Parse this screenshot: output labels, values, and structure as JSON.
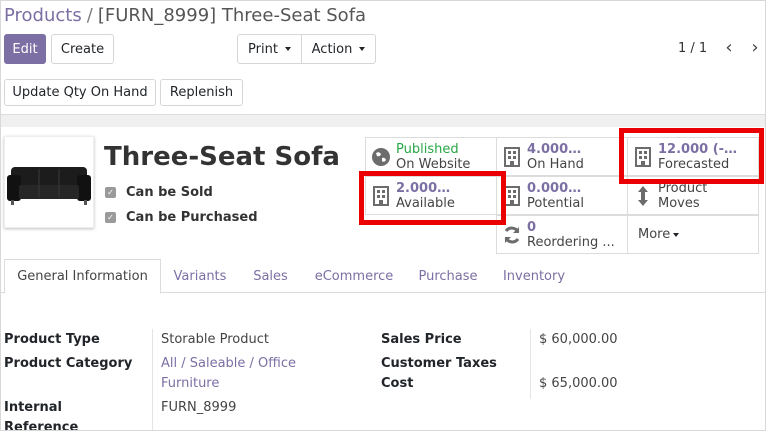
{
  "breadcrumb": {
    "parent": "Products",
    "separator": "/",
    "current": "[FURN_8999] Three-Seat Sofa"
  },
  "toolbar": {
    "edit": "Edit",
    "create": "Create",
    "print": "Print",
    "action": "Action",
    "pager": "1 / 1",
    "prev": "‹",
    "next": "›",
    "update_qty": "Update Qty On Hand",
    "replenish": "Replenish"
  },
  "product": {
    "name": "Three-Seat Sofa",
    "can_be_sold": "Can be Sold",
    "can_be_purchased": "Can be Purchased",
    "check_mark": "✓"
  },
  "smart_buttons": {
    "published": {
      "value": "Published",
      "label": "On Website"
    },
    "on_hand": {
      "value": "4.000…",
      "label": "On Hand"
    },
    "forecasted": {
      "value": "12.000 (-…",
      "label": "Forecasted"
    },
    "available": {
      "value": "2.000…",
      "label": "Available"
    },
    "potential": {
      "value": "0.000…",
      "label": "Potential"
    },
    "product_moves": {
      "line1": "Product",
      "line2": "Moves"
    },
    "reordering": {
      "value": "0",
      "label": "Reordering ..."
    },
    "more": "More"
  },
  "tabs": [
    "General Information",
    "Variants",
    "Sales",
    "eCommerce",
    "Purchase",
    "Inventory"
  ],
  "fields": {
    "product_type": {
      "label": "Product Type",
      "value": "Storable Product"
    },
    "product_category": {
      "label": "Product Category",
      "value_line1": "All / Saleable / Office",
      "value_line2": "Furniture"
    },
    "internal_reference": {
      "label_line1": "Internal",
      "label_line2": "Reference",
      "value": "FURN_8999"
    },
    "sales_price": {
      "label": "Sales Price",
      "value": "$ 60,000.00"
    },
    "customer_taxes": {
      "label": "Customer Taxes",
      "value": ""
    },
    "cost": {
      "label": "Cost",
      "value": "$ 65,000.00"
    }
  },
  "colors": {
    "accent": "#7c6fa3",
    "highlight": "#ea0000",
    "published": "#28a745"
  }
}
